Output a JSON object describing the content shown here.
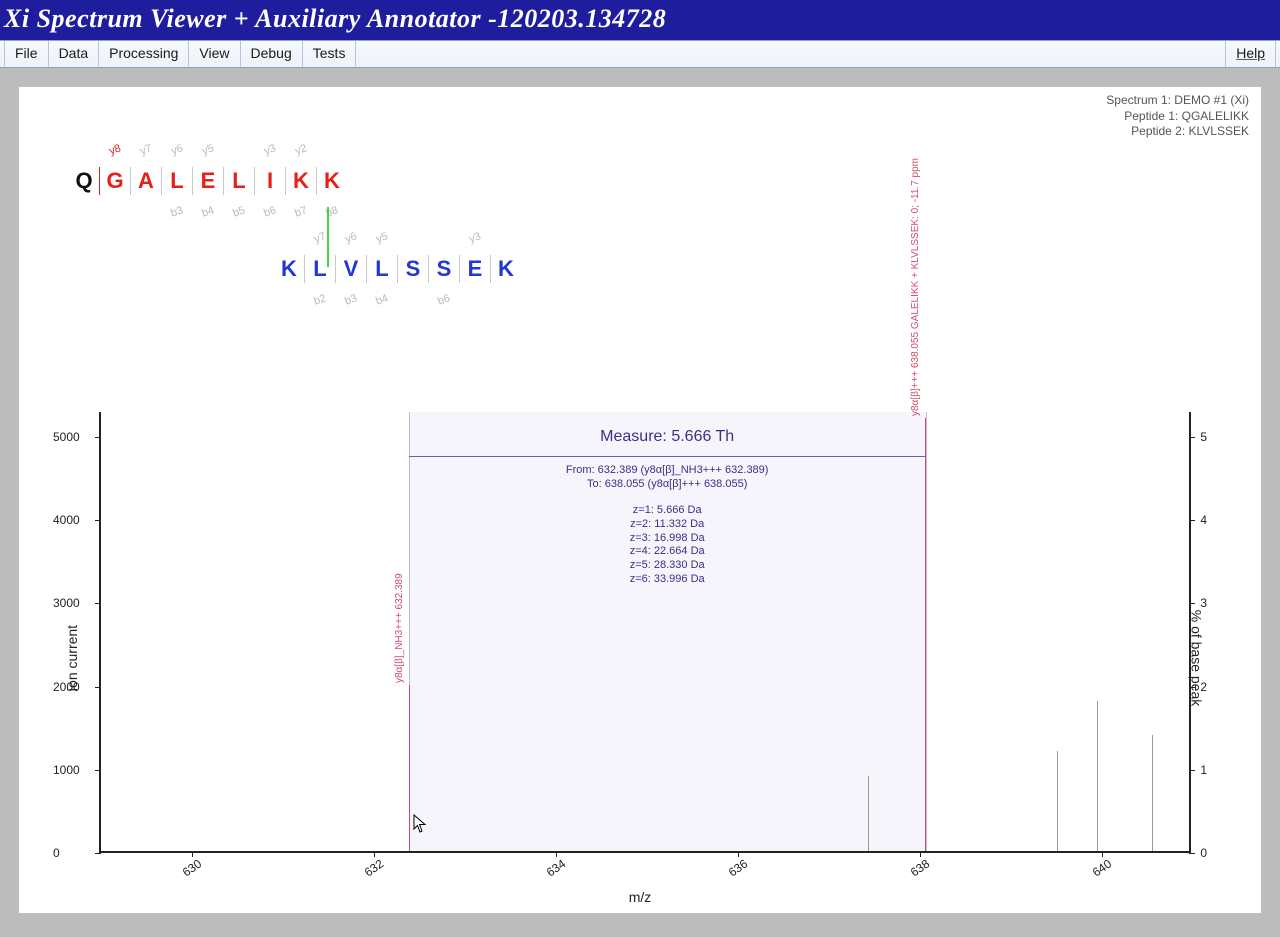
{
  "title": "Xi Spectrum Viewer + Auxiliary Annotator -120203.134728",
  "menu": {
    "items": [
      "File",
      "Data",
      "Processing",
      "View",
      "Debug",
      "Tests"
    ],
    "help": "Help"
  },
  "meta": {
    "line1": "Spectrum 1: DEMO #1 (Xi)",
    "line2": "Peptide 1: QGALELIKK",
    "line3": "Peptide 2: KLVLSSEK"
  },
  "peptide1": {
    "residues": [
      "Q",
      "G",
      "A",
      "L",
      "E",
      "L",
      "I",
      "K",
      "K"
    ],
    "colors": [
      "black",
      "red",
      "red",
      "red",
      "red",
      "red",
      "red",
      "red",
      "red"
    ],
    "y_frags": [
      "",
      "y8",
      "y7",
      "y6",
      "y5",
      "",
      "y3",
      "y2",
      ""
    ],
    "y_active": [
      false,
      true,
      false,
      false,
      false,
      false,
      false,
      false,
      false
    ],
    "b_frags": [
      "",
      "",
      "",
      "b3",
      "b4",
      "b5",
      "b6",
      "b7",
      "b8"
    ],
    "crosslink_after_index": 7
  },
  "peptide2": {
    "residues": [
      "K",
      "L",
      "V",
      "L",
      "S",
      "S",
      "E",
      "K"
    ],
    "y_frags": [
      "",
      "y7",
      "y6",
      "y5",
      "",
      "",
      "y3",
      ""
    ],
    "b_frags": [
      "",
      "b2",
      "b3",
      "b4",
      "",
      "b6",
      "",
      ""
    ]
  },
  "chart_data": {
    "type": "bar",
    "xlabel": "m/z",
    "ylabel_left": "ion current",
    "ylabel_right": "% of base peak",
    "xlim": [
      629,
      641
    ],
    "ylim_left": [
      0,
      5300
    ],
    "ylim_right": [
      0,
      5.3
    ],
    "x_ticks": [
      630,
      632,
      634,
      636,
      638,
      640
    ],
    "y_ticks_left": [
      0,
      1000,
      2000,
      3000,
      4000,
      5000
    ],
    "y_ticks_right": [
      0,
      1,
      2,
      3,
      4,
      5
    ],
    "annotated_peaks": [
      {
        "mz": 632.389,
        "intensity": 2000,
        "label": "y8α[β]_NH3+++ 632.389"
      },
      {
        "mz": 638.055,
        "intensity": 5200,
        "label": "y8α[β]+++ 638.055\\nGALELIKK + KLVLSSEK: 0; -11.7 ppm"
      }
    ],
    "unannotated_peaks": [
      {
        "mz": 637.43,
        "intensity": 900
      },
      {
        "mz": 639.5,
        "intensity": 1200
      },
      {
        "mz": 639.95,
        "intensity": 1800
      },
      {
        "mz": 640.55,
        "intensity": 1400
      }
    ],
    "measure": {
      "title": "Measure: 5.666 Th",
      "from": "From: 632.389 (y8α[β]_NH3+++ 632.389)",
      "to": "To: 638.055 (y8α[β]+++ 638.055)",
      "masses": [
        "z=1: 5.666 Da",
        "z=2: 11.332 Da",
        "z=3: 16.998 Da",
        "z=4: 22.664 Da",
        "z=5: 28.330 Da",
        "z=6: 33.996 Da"
      ],
      "x_from": 632.389,
      "x_to": 638.055
    }
  },
  "cursor": {
    "mz": 632.45,
    "intensity": 450
  }
}
